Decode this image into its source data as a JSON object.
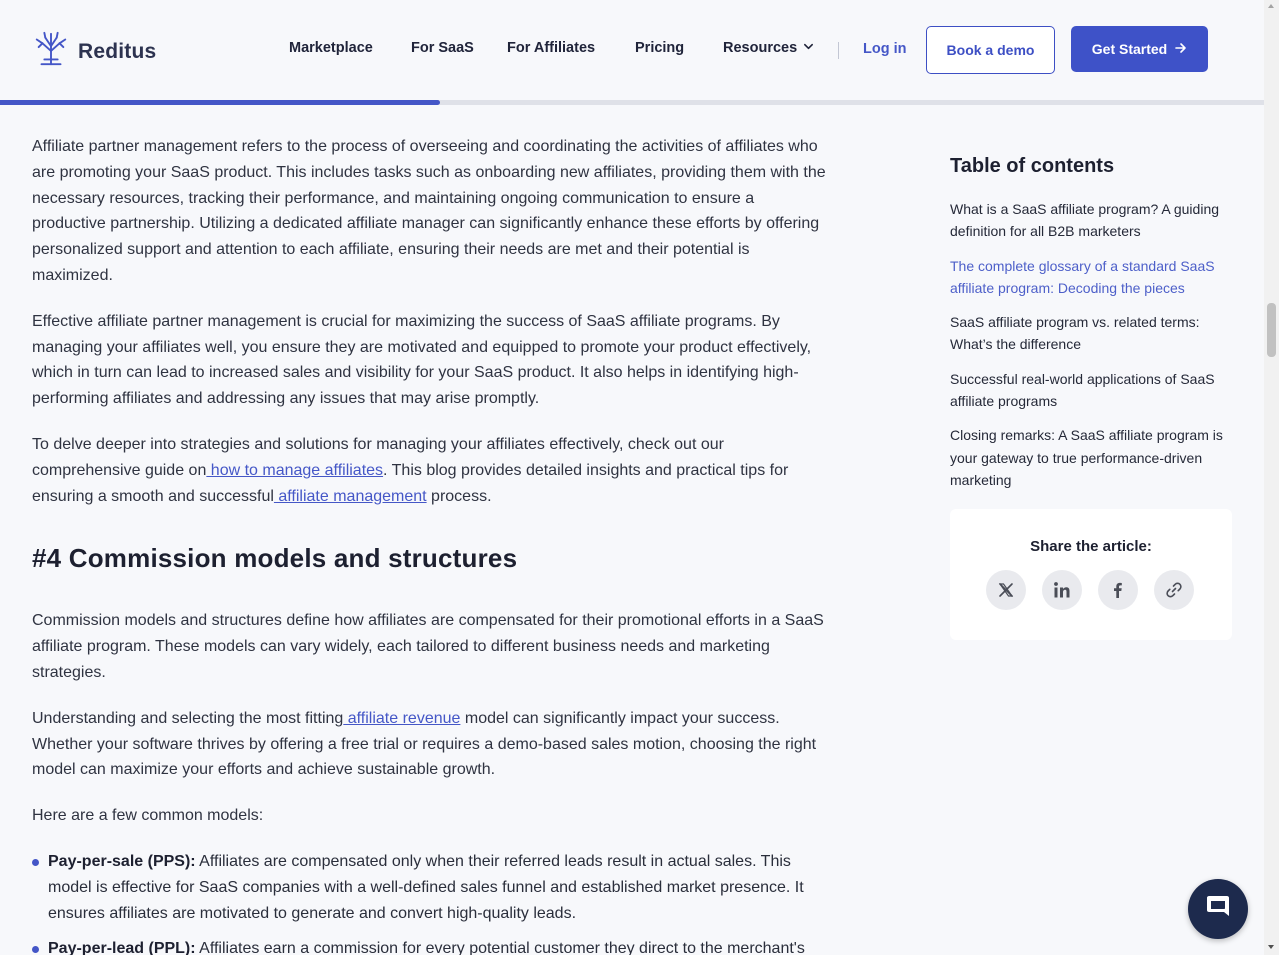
{
  "brand": {
    "name": "Reditus",
    "accent": "#4456c7",
    "logo_icon": "tree-logo-icon"
  },
  "nav": {
    "items": [
      "Marketplace",
      "For SaaS",
      "For Affiliates",
      "Pricing",
      "Resources"
    ],
    "resources_icon": "chevron-down-icon",
    "login": "Log in",
    "book_demo": "Book a demo",
    "get_started": "Get Started",
    "get_started_icon": "arrow-right-icon"
  },
  "reading_progress": {
    "fraction": 0.348
  },
  "article": {
    "p1": "Affiliate partner management refers to the process of overseeing and coordinating the activities of affiliates who are promoting your SaaS product. This includes tasks such as onboarding new affiliates, providing them with the necessary resources, tracking their performance, and maintaining ongoing communication to ensure a productive partnership. Utilizing a dedicated affiliate manager can significantly enhance these efforts by offering personalized support and attention to each affiliate, ensuring their needs are met and their potential is maximized.",
    "p2": "Effective affiliate partner management is crucial for maximizing the success of SaaS affiliate programs. By managing your affiliates well, you ensure they are motivated and equipped to promote your product effectively, which in turn can lead to increased sales and visibility for your SaaS product. It also helps in identifying high-performing affiliates and addressing any issues that may arise promptly.",
    "p3_a": "To delve deeper into strategies and solutions for managing your affiliates effectively, check out our comprehensive guide on",
    "p3_link1": " how to manage affiliates",
    "p3_b": ". This blog provides detailed insights and practical tips for ensuring a smooth and successful",
    "p3_link2": " affiliate management",
    "p3_c": " process.",
    "h2": "#4 Commission models and structures",
    "p4": "Commission models and structures define how affiliates are compensated for their promotional efforts in a SaaS affiliate program. These models can vary widely, each tailored to different business needs and marketing strategies.",
    "p5_a": "Understanding and selecting the most fitting",
    "p5_link": " affiliate revenue",
    "p5_b": " model can significantly impact your success. Whether your software thrives by offering a free trial or requires a demo-based sales motion, choosing the right model can maximize your efforts and achieve sustainable growth.",
    "p6": "Here are a few common models:",
    "bullets": [
      {
        "term": "Pay-per-sale (PPS):",
        "text": " Affiliates are compensated only when their referred leads result in actual sales. This model is effective for SaaS companies with a well-defined sales funnel and established market presence. It ensures affiliates are motivated to generate and convert high-quality leads."
      },
      {
        "term": "Pay-per-lead (PPL):",
        "text": " Affiliates earn a commission for every potential customer they direct to the merchant's"
      }
    ]
  },
  "toc": {
    "title": "Table of contents",
    "items": [
      "What is a SaaS affiliate program? A guiding definition for all B2B marketers",
      "The complete glossary of a standard SaaS affiliate program: Decoding the pieces",
      "SaaS affiliate program vs. related terms: What’s the difference",
      "Successful real-world applications of SaaS affiliate programs",
      "Closing remarks: A SaaS affiliate program is your gateway to true performance-driven marketing"
    ],
    "active_index": 1
  },
  "share": {
    "title": "Share the article:",
    "icons": [
      "x-icon",
      "linkedin-icon",
      "facebook-icon",
      "link-icon"
    ]
  },
  "chat": {
    "icon": "chat-bubble-icon"
  }
}
